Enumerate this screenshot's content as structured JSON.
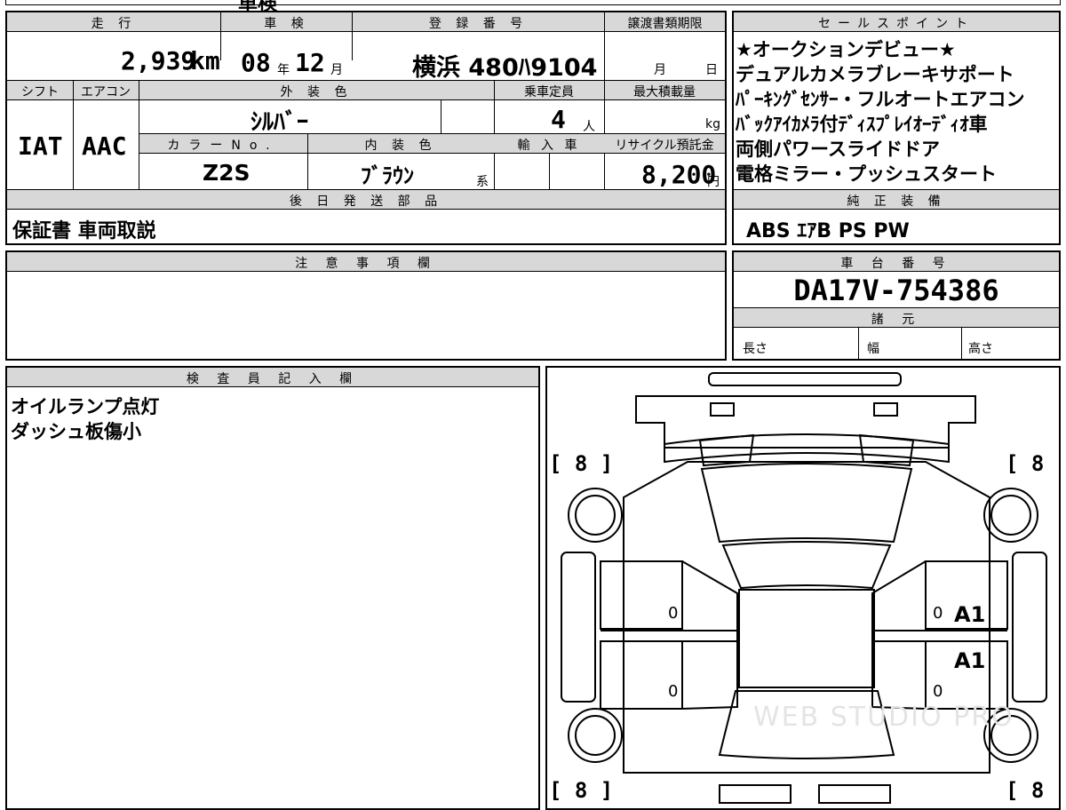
{
  "top_fragment": "車検",
  "labels": {
    "mileage": "走 行",
    "shaken": "車 検",
    "registration": "登 録 番 号",
    "transfer_deadline": "譲渡書類期限",
    "sales_points": "セールスポイント",
    "shift": "シフト",
    "aircon": "エアコン",
    "exterior_color": "外 装 色",
    "capacity": "乗車定員",
    "max_load": "最大積載量",
    "color_no": "カラーNo.",
    "interior_color": "内 装 色",
    "import": "輸 入 車",
    "recycle": "リサイクル預託金",
    "later_parts": "後 日 発 送 部 品",
    "genuine_equipment": "純 正 装 備",
    "notes": "注 意 事 項 欄",
    "chassis_no": "車 台 番 号",
    "specs": "諸 元",
    "length": "長さ",
    "width": "幅",
    "height": "高さ",
    "inspector": "検 査 員 記 入 欄"
  },
  "vehicle": {
    "mileage_value": "2,939",
    "mileage_unit": "km",
    "shaken_year": "08",
    "shaken_year_unit": "年",
    "shaken_month": "12",
    "shaken_month_unit": "月",
    "plate": "横浜 480ﾊ9104",
    "deadline_month_unit": "月",
    "deadline_day_unit": "日",
    "shift": "IAT",
    "aircon": "AAC",
    "exterior_color": "ｼﾙﾊﾞｰ",
    "capacity_value": "4",
    "capacity_unit": "人",
    "max_load_unit": "kg",
    "color_no": "Z2S",
    "interior_color": "ﾌﾞﾗｳﾝ",
    "interior_suffix": "系",
    "recycle_value": "8,200",
    "recycle_unit": "円",
    "later_parts": "保証書 車両取説",
    "genuine_equipment": "ABS ｴｱB PS PW",
    "chassis_no": "DA17V-754386"
  },
  "sales_points": [
    "★オークションデビュー★",
    "デュアルカメラブレーキサポート",
    "ﾊﾟｰｷﾝｸﾞｾﾝｻｰ・フルオートエアコン",
    "ﾊﾞｯｸｱｲｶﾒﾗ付ﾃﾞｨｽﾌﾟﾚｲｵｰﾃﾞｨｵ車",
    "両側パワースライドドア",
    "電格ミラー・プッシュスタート"
  ],
  "inspector_notes": [
    "オイルランプ点灯",
    "ダッシュ板傷小"
  ],
  "diagram": {
    "tire_fl": "[ 8 ]",
    "tire_fr": "[ 8 ]",
    "tire_rl": "[ 8 ]",
    "tire_rr": "[ 8 ]",
    "door_left_front": "0",
    "door_left_rear": "0",
    "door_right_front": "0",
    "door_right_rear": "0",
    "mark_right_front": "A1",
    "mark_right_rear": "A1",
    "watermark": "WEB STUDIO PRO"
  }
}
